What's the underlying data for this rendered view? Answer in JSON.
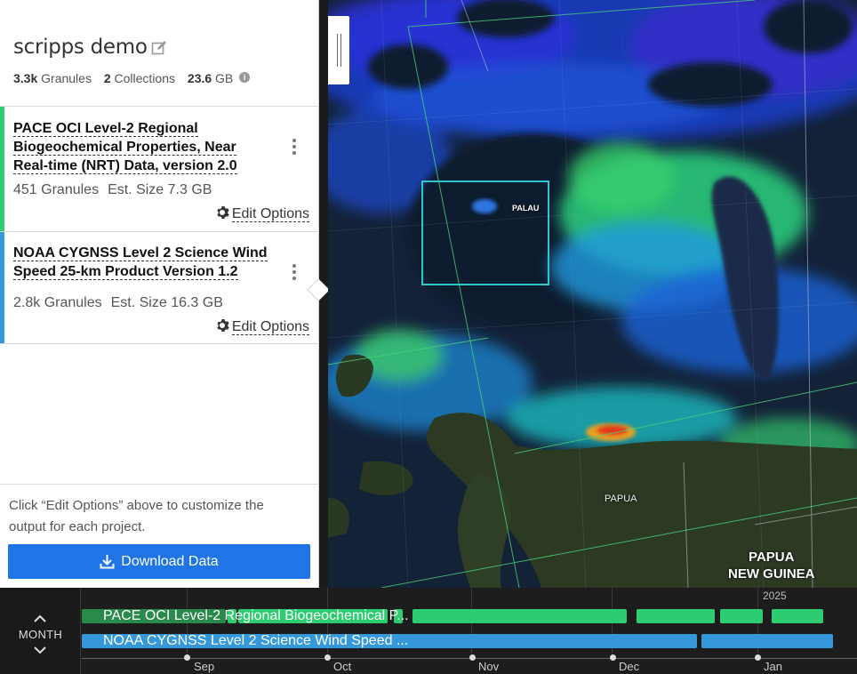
{
  "project": {
    "title": "scripps demo",
    "granules_count": "3.3k",
    "granules_label": "Granules",
    "collections_count": "2",
    "collections_label": "Collections",
    "size_value": "23.6",
    "size_unit": "GB"
  },
  "collections": [
    {
      "title": "PACE OCI Level-2 Regional Biogeochemical Properties, Near Real-time (NRT) Data, version 2.0",
      "granules": "451 Granules",
      "size": "Est. Size 7.3 GB",
      "edit_label": "Edit Options",
      "color": "#2ecc71"
    },
    {
      "title": "NOAA CYGNSS Level 2 Science Wind Speed 25-km Product Version 1.2",
      "granules": "2.8k Granules",
      "size": "Est. Size 16.3 GB",
      "edit_label": "Edit Options",
      "color": "#3498db"
    }
  ],
  "footer": {
    "hint": "Click “Edit Options” above to customize the output for each project.",
    "download_label": "Download Data"
  },
  "map": {
    "labels": {
      "palau": "PALAU",
      "papua": "PAPUA",
      "png_line1": "PAPUA",
      "png_line2": "NEW GUINEA"
    }
  },
  "timeline": {
    "zoom_level": "MONTH",
    "year_label": "2025",
    "tracks": [
      {
        "name": "PACE OCI Level-2 Regional Biogeochemical P...",
        "color": "#2ecc71"
      },
      {
        "name": "NOAA CYGNSS Level 2 Science Wind Speed ...",
        "color": "#3498db"
      }
    ],
    "months": [
      "Sep",
      "Oct",
      "Nov",
      "Dec",
      "Jan"
    ]
  }
}
